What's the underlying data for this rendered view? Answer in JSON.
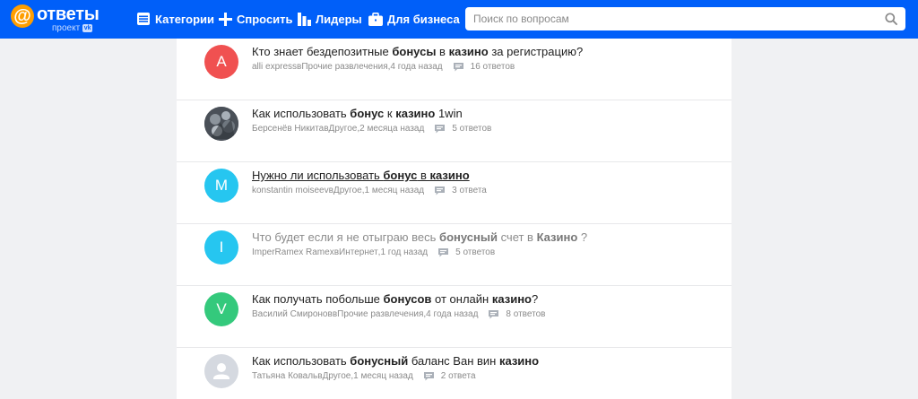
{
  "header": {
    "logo_text": "ответы",
    "logo_sub": "проект",
    "logo_badge": "vk",
    "nav": [
      {
        "label": "Категории",
        "icon": "list-icon"
      },
      {
        "label": "Спросить",
        "icon": "plus-icon"
      },
      {
        "label": "Лидеры",
        "icon": "bar-chart-icon"
      },
      {
        "label": "Для бизнеса",
        "icon": "briefcase-icon"
      }
    ],
    "search_placeholder": "Поиск по вопросам"
  },
  "colors": {
    "brand": "#005ff9",
    "logo_accent": "#ff9e00",
    "avatar_a": "#f05151",
    "avatar_m": "#26c6f0",
    "avatar_i": "#26c6f0",
    "avatar_v": "#34c97c",
    "avatar_default": "#d5d9e0"
  },
  "questions": [
    {
      "avatar_letter": "A",
      "title_parts": [
        "Кто знает бездепозитные ",
        "бонусы",
        " в ",
        "казино",
        " за регистрацию?"
      ],
      "author": "alli express",
      "category": "Прочие развлечения",
      "time": "4 года назад",
      "answers": "16 ответов",
      "meta_in": " в ",
      "meta_sep": ", "
    },
    {
      "avatar_letter": "",
      "title_parts": [
        "Как использовать ",
        "бонус",
        " к ",
        "казино",
        " 1win"
      ],
      "author": "Берсенёв Никита",
      "category": "Другое",
      "time": "2 месяца назад",
      "answers": "5 ответов",
      "meta_in": " в ",
      "meta_sep": ", "
    },
    {
      "avatar_letter": "M",
      "title_parts": [
        "Нужно ли использовать ",
        "бонус",
        " в ",
        "казино",
        ""
      ],
      "author": "konstantin moiseev",
      "category": "Другое",
      "time": "1 месяц назад",
      "answers": "3 ответа",
      "meta_in": " в ",
      "meta_sep": ", "
    },
    {
      "avatar_letter": "I",
      "title_parts": [
        "Что будет если я не отыграю весь ",
        "бонусный",
        " счет в ",
        "Казино",
        " ?"
      ],
      "author": "ImperRamex Ramex",
      "category": "Интернет",
      "time": "1 год назад",
      "answers": "5 ответов",
      "meta_in": " в ",
      "meta_sep": ", "
    },
    {
      "avatar_letter": "V",
      "title_parts": [
        "Как получать побольше ",
        "бонусов",
        " от онлайн ",
        "казино",
        "?"
      ],
      "author": "Василий Смиронов",
      "category": "Прочие развлечения",
      "time": "4 года назад",
      "answers": "8 ответов",
      "meta_in": " в ",
      "meta_sep": ", "
    },
    {
      "avatar_letter": "",
      "title_parts": [
        "Как использовать ",
        "бонусный",
        " баланс Ван вин ",
        "казино",
        ""
      ],
      "author": "Татьяна Коваль",
      "category": "Другое",
      "time": "1 месяц назад",
      "answers": "2 ответа",
      "meta_in": " в ",
      "meta_sep": ", "
    }
  ]
}
